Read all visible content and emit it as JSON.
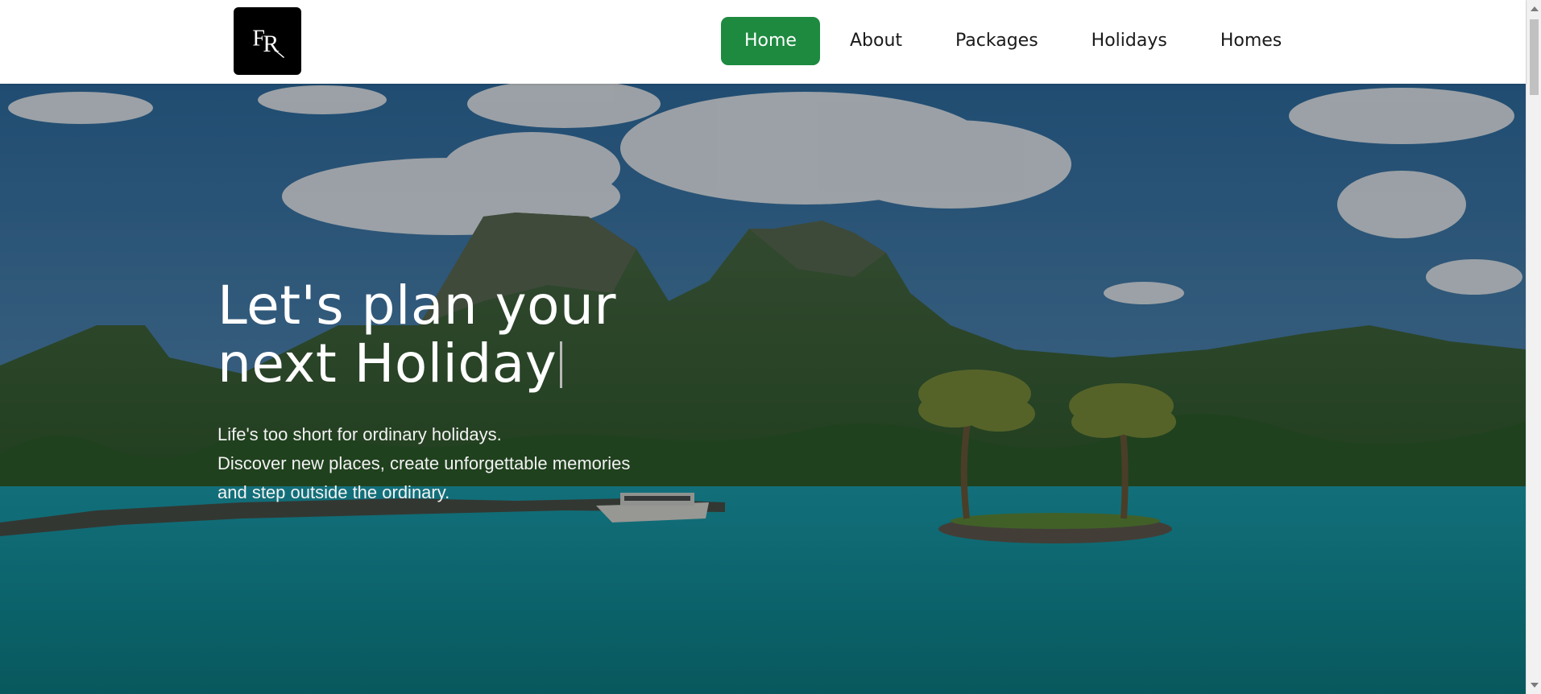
{
  "brand": {
    "logo_text": "FR",
    "logo_icon": "fr-monogram-logo"
  },
  "nav": {
    "items": [
      {
        "label": "Home",
        "active": true
      },
      {
        "label": "About",
        "active": false
      },
      {
        "label": "Packages",
        "active": false
      },
      {
        "label": "Holidays",
        "active": false
      },
      {
        "label": "Homes",
        "active": false
      }
    ]
  },
  "hero": {
    "title_line1": "Let's plan your",
    "title_line2": "next Holiday",
    "subtitle_line1": "Life's too short for ordinary holidays.",
    "subtitle_line2": "Discover new places, create unforgettable memories",
    "subtitle_line3": "and step outside the ordinary.",
    "background": "tropical-lagoon-island-mountains-photo"
  },
  "colors": {
    "accent": "#1e8a40",
    "logo_bg": "#000000",
    "nav_text": "#1a1a1a",
    "hero_text": "#ffffff"
  }
}
